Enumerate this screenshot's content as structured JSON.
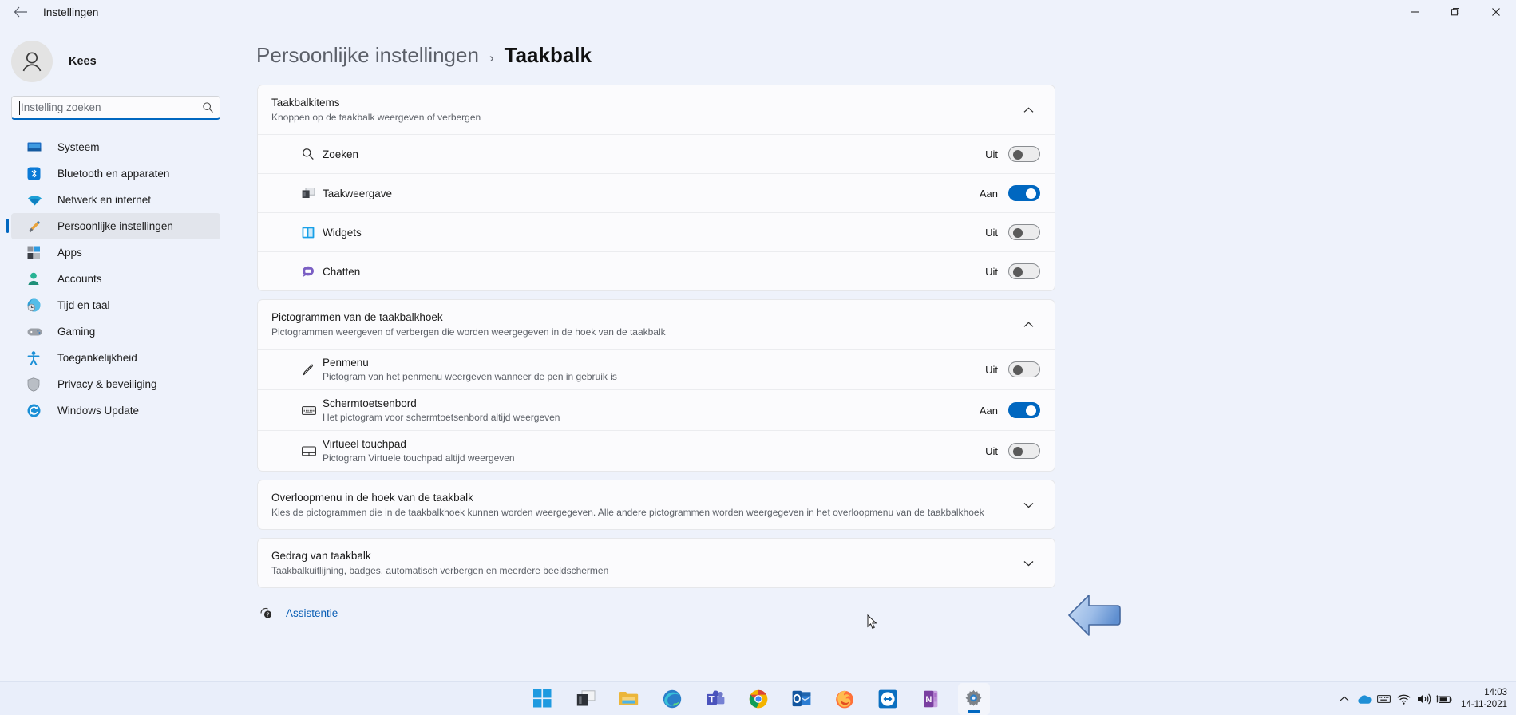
{
  "window": {
    "title": "Instellingen",
    "back_icon": "back-arrow-icon",
    "minimize_label": "—",
    "maximize_label": "▭",
    "close_label": "✕"
  },
  "sidebar": {
    "profile": {
      "name": "Kees",
      "avatar_icon": "user-avatar-icon"
    },
    "search": {
      "placeholder": "Instelling zoeken",
      "value": "",
      "icon": "search-icon"
    },
    "items": [
      {
        "label": "Systeem",
        "icon": "monitor-icon",
        "selected": false
      },
      {
        "label": "Bluetooth en apparaten",
        "icon": "bluetooth-icon",
        "selected": false
      },
      {
        "label": "Netwerk en internet",
        "icon": "wifi-icon",
        "selected": false
      },
      {
        "label": "Persoonlijke instellingen",
        "icon": "paintbrush-icon",
        "selected": true
      },
      {
        "label": "Apps",
        "icon": "apps-icon",
        "selected": false
      },
      {
        "label": "Accounts",
        "icon": "account-icon",
        "selected": false
      },
      {
        "label": "Tijd en taal",
        "icon": "clock-globe-icon",
        "selected": false
      },
      {
        "label": "Gaming",
        "icon": "gamepad-icon",
        "selected": false
      },
      {
        "label": "Toegankelijkheid",
        "icon": "accessibility-icon",
        "selected": false
      },
      {
        "label": "Privacy & beveiliging",
        "icon": "shield-icon",
        "selected": false
      },
      {
        "label": "Windows Update",
        "icon": "update-icon",
        "selected": false
      }
    ]
  },
  "breadcrumb": {
    "parent": "Persoonlijke instellingen",
    "separator": "›",
    "current": "Taakbalk"
  },
  "sections": [
    {
      "title": "Taakbalkitems",
      "subtitle": "Knoppen op de taakbalk weergeven of verbergen",
      "expanded": true,
      "chevron": "chevron-up-icon",
      "rows": [
        {
          "title": "Zoeken",
          "sub": "",
          "icon": "search-icon",
          "toggle_label": "Uit",
          "toggle_on": false
        },
        {
          "title": "Taakweergave",
          "sub": "",
          "icon": "task-view-icon",
          "toggle_label": "Aan",
          "toggle_on": true
        },
        {
          "title": "Widgets",
          "sub": "",
          "icon": "widgets-icon",
          "toggle_label": "Uit",
          "toggle_on": false
        },
        {
          "title": "Chatten",
          "sub": "",
          "icon": "chat-icon",
          "toggle_label": "Uit",
          "toggle_on": false
        }
      ]
    },
    {
      "title": "Pictogrammen van de taakbalkhoek",
      "subtitle": "Pictogrammen weergeven of verbergen die worden weergegeven in de hoek van de taakbalk",
      "expanded": true,
      "chevron": "chevron-up-icon",
      "rows": [
        {
          "title": "Penmenu",
          "sub": "Pictogram van het penmenu weergeven wanneer de pen in gebruik is",
          "icon": "pen-icon",
          "toggle_label": "Uit",
          "toggle_on": false
        },
        {
          "title": "Schermtoetsenbord",
          "sub": "Het pictogram voor schermtoetsenbord altijd weergeven",
          "icon": "keyboard-icon",
          "toggle_label": "Aan",
          "toggle_on": true
        },
        {
          "title": "Virtueel touchpad",
          "sub": "Pictogram Virtuele touchpad altijd weergeven",
          "icon": "touchpad-icon",
          "toggle_label": "Uit",
          "toggle_on": false
        }
      ]
    },
    {
      "title": "Overloopmenu in de hoek van de taakbalk",
      "subtitle": "Kies de pictogrammen die in de taakbalkhoek kunnen worden weergegeven. Alle andere pictogrammen worden weergegeven in het overloopmenu van de taakbalkhoek",
      "expanded": false,
      "chevron": "chevron-down-icon",
      "rows": []
    },
    {
      "title": "Gedrag van taakbalk",
      "subtitle": "Taakbalkuitlijning, badges, automatisch verbergen en meerdere beeldschermen",
      "expanded": false,
      "chevron": "chevron-down-icon",
      "rows": []
    }
  ],
  "assistance": {
    "label": "Assistentie",
    "icon": "help-question-icon"
  },
  "annotation": {
    "arrow_icon": "left-arrow-annotation"
  },
  "taskbar": {
    "apps": [
      {
        "name": "start-button"
      },
      {
        "name": "task-view-button"
      },
      {
        "name": "file-explorer"
      },
      {
        "name": "microsoft-edge"
      },
      {
        "name": "microsoft-teams"
      },
      {
        "name": "google-chrome"
      },
      {
        "name": "microsoft-outlook"
      },
      {
        "name": "mozilla-firefox"
      },
      {
        "name": "teamviewer"
      },
      {
        "name": "microsoft-onenote"
      },
      {
        "name": "settings"
      }
    ],
    "tray": {
      "chevron_icon": "tray-overflow-chevron-icon",
      "onedrive_icon": "onedrive-icon",
      "keyboard_icon": "keyboard-tray-icon",
      "wifi_icon": "wifi-tray-icon",
      "volume_icon": "volume-tray-icon",
      "battery_icon": "battery-tray-icon",
      "time": "14:03",
      "date": "14-11-2021"
    }
  },
  "colors": {
    "accent": "#0067c0",
    "page_bg": "#eef2fb",
    "card_bg": "#fbfbfd",
    "link": "#0b5fb5"
  }
}
